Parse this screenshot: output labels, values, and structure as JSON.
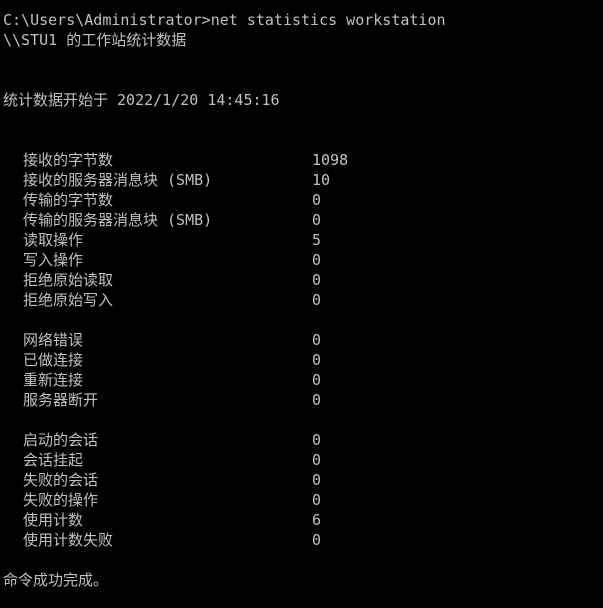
{
  "command": "C:\\Users\\Administrator>net statistics workstation",
  "header": "\\\\STU1 的工作站统计数据",
  "since": "统计数据开始于 2022/1/20 14:45:16",
  "groups": [
    [
      {
        "label": "接收的字节数",
        "value": "1098"
      },
      {
        "label": "接收的服务器消息块 (SMB)",
        "value": "10"
      },
      {
        "label": "传输的字节数",
        "value": "0"
      },
      {
        "label": "传输的服务器消息块 (SMB)",
        "value": "0"
      },
      {
        "label": "读取操作",
        "value": "5"
      },
      {
        "label": "写入操作",
        "value": "0"
      },
      {
        "label": "拒绝原始读取",
        "value": "0"
      },
      {
        "label": "拒绝原始写入",
        "value": "0"
      }
    ],
    [
      {
        "label": "网络错误",
        "value": "0"
      },
      {
        "label": "已做连接",
        "value": "0"
      },
      {
        "label": "重新连接",
        "value": "0"
      },
      {
        "label": "服务器断开",
        "value": "0"
      }
    ],
    [
      {
        "label": "启动的会话",
        "value": "0"
      },
      {
        "label": "会话挂起",
        "value": "0"
      },
      {
        "label": "失败的会话",
        "value": "0"
      },
      {
        "label": "失败的操作",
        "value": "0"
      },
      {
        "label": "使用计数",
        "value": "6"
      },
      {
        "label": "使用计数失败",
        "value": "0"
      }
    ]
  ],
  "footer": "命令成功完成。"
}
